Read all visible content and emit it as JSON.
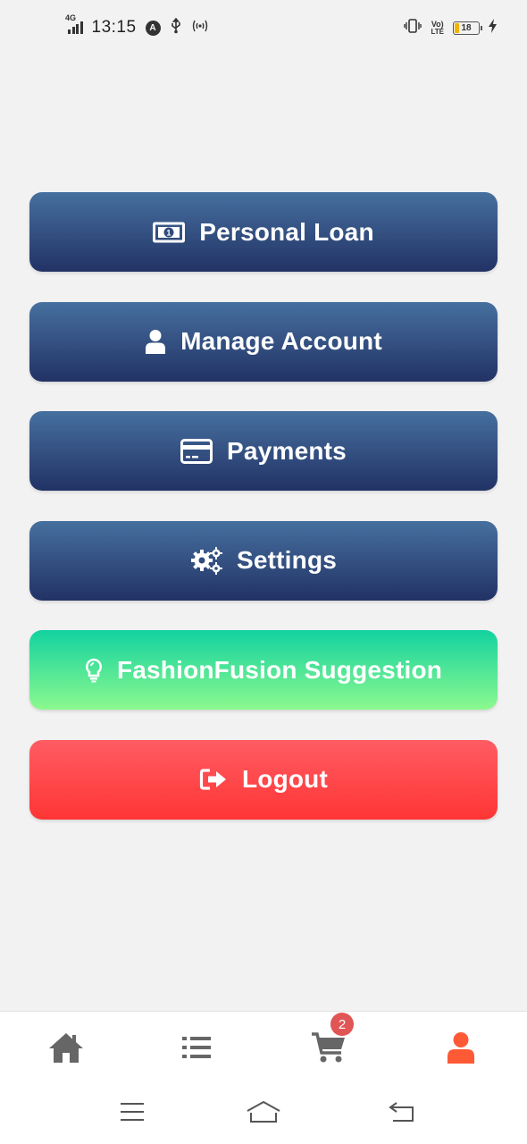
{
  "status_bar": {
    "network": "4G",
    "time": "13:15",
    "volte_top": "Vo)",
    "volte_bottom": "LTE",
    "battery": "18"
  },
  "menu": {
    "items": [
      {
        "label": "Personal Loan",
        "icon": "money-bill-icon",
        "style": "blue"
      },
      {
        "label": "Manage Account",
        "icon": "user-icon",
        "style": "blue"
      },
      {
        "label": "Payments",
        "icon": "credit-card-icon",
        "style": "blue"
      },
      {
        "label": "Settings",
        "icon": "gears-icon",
        "style": "blue"
      },
      {
        "label": "FashionFusion Suggestion",
        "icon": "lightbulb-icon",
        "style": "green"
      },
      {
        "label": "Logout",
        "icon": "sign-out-icon",
        "style": "red"
      }
    ]
  },
  "bottom_nav": {
    "items": [
      {
        "name": "home",
        "icon": "home-icon",
        "active": false
      },
      {
        "name": "list",
        "icon": "list-icon",
        "active": false
      },
      {
        "name": "cart",
        "icon": "cart-icon",
        "active": false
      },
      {
        "name": "profile",
        "icon": "user-icon",
        "active": true
      }
    ],
    "cart_badge": "2"
  },
  "colors": {
    "blue_top": "#46709f",
    "blue_bottom": "#223265",
    "green_top": "#12d2a0",
    "green_bottom": "#8cf98e",
    "red": "#ff3f45",
    "nav_inactive": "#666666",
    "nav_active": "#ff5a36",
    "badge": "#e05555"
  }
}
